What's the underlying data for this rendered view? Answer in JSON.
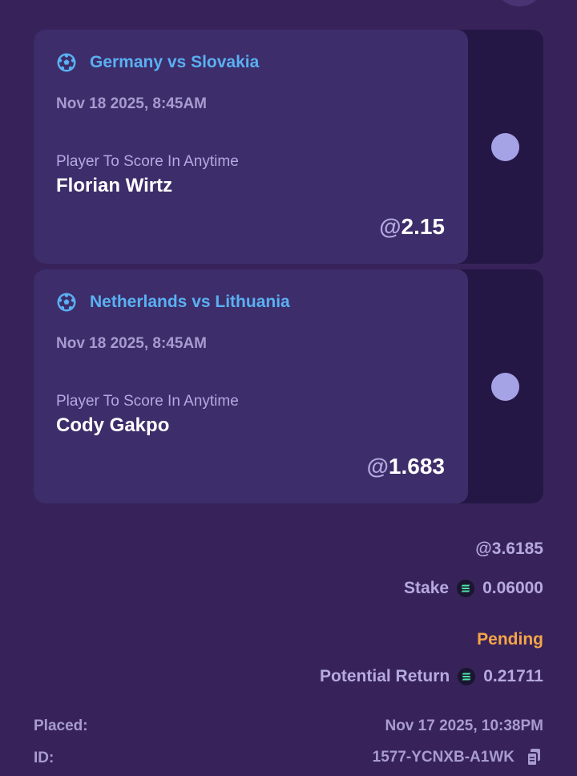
{
  "legs": [
    {
      "match": "Germany vs Slovakia",
      "date": "Nov 18 2025, 8:45AM",
      "market": "Player To Score In Anytime",
      "selection": "Florian Wirtz",
      "odds_prefix": "@",
      "odds": "2.15",
      "icon": "soccer-ball-icon"
    },
    {
      "match": "Netherlands vs Lithuania",
      "date": "Nov 18 2025, 8:45AM",
      "market": "Player To Score In Anytime",
      "selection": "Cody Gakpo",
      "odds_prefix": "@",
      "odds": "1.683",
      "icon": "soccer-ball-icon"
    }
  ],
  "summary": {
    "total_odds": "@3.6185",
    "stake_label": "Stake",
    "stake_value": "0.06000",
    "status": "Pending",
    "return_label": "Potential Return",
    "return_value": "0.21711",
    "currency_icon": "solana-icon"
  },
  "meta": {
    "placed_label": "Placed:",
    "placed_value": "Nov 17 2025, 10:38PM",
    "id_label": "ID:",
    "id_value": "1577-YCNXB-A1WK"
  },
  "colors": {
    "background": "#37235a",
    "card": "#3d2d6a",
    "match_link": "#5ab0f2",
    "pending": "#f5a448",
    "muted_text": "#a79bd0"
  }
}
